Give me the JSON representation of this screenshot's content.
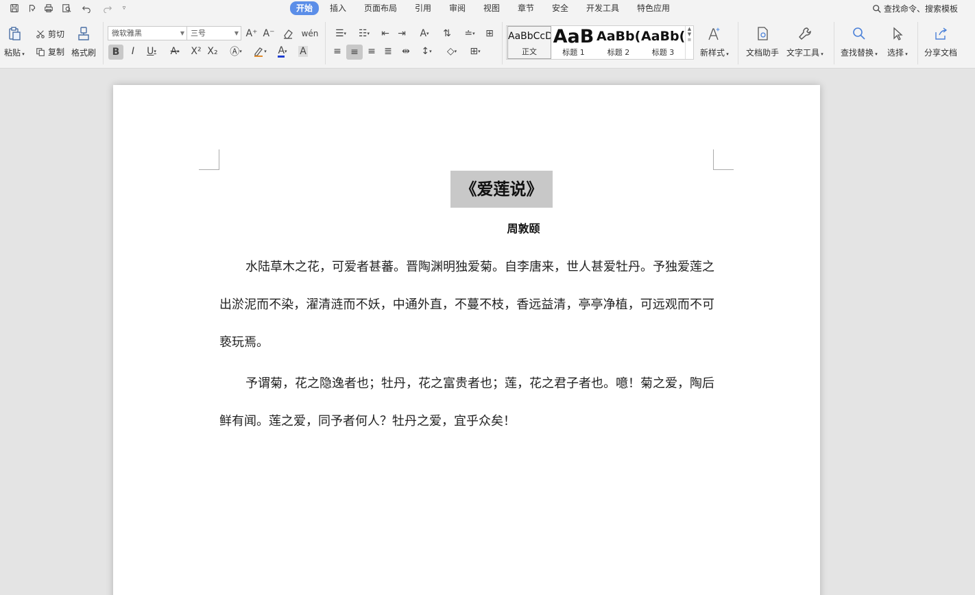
{
  "app": {
    "tabs": [
      "开始",
      "插入",
      "页面布局",
      "引用",
      "审阅",
      "视图",
      "章节",
      "安全",
      "开发工具",
      "特色应用"
    ],
    "active_tab": "开始",
    "command_search": "查找命令、搜索模板"
  },
  "ribbon": {
    "paste": "粘贴",
    "cut": "剪切",
    "copy": "复制",
    "format_painter": "格式刷",
    "font_name": "微软雅黑",
    "font_size": "三号",
    "styles": [
      {
        "sample": "AaBbCcD",
        "label": "正文"
      },
      {
        "sample": "AaB",
        "label": "标题 1"
      },
      {
        "sample": "AaBb(",
        "label": "标题 2"
      },
      {
        "sample": "AaBb(",
        "label": "标题 3"
      }
    ],
    "new_style": "新样式",
    "doc_assistant": "文档助手",
    "text_tools": "文字工具",
    "find_replace": "查找替换",
    "select": "选择",
    "share_doc": "分享文档"
  },
  "document": {
    "title": "《爱莲说》",
    "author": "周敦颐",
    "paragraphs": [
      "水陆草木之花，可爱者甚蕃。晋陶渊明独爱菊。自李唐来，世人甚爱牡丹。予独爱莲之出淤泥而不染，濯清涟而不妖，中通外直，不蔓不枝，香远益清，亭亭净植，可远观而不可亵玩焉。",
      "予谓菊，花之隐逸者也；牡丹，花之富贵者也；莲，花之君子者也。噫！菊之爱，陶后鲜有闻。莲之爱，同予者何人？牡丹之爱，宜乎众矣！"
    ]
  }
}
